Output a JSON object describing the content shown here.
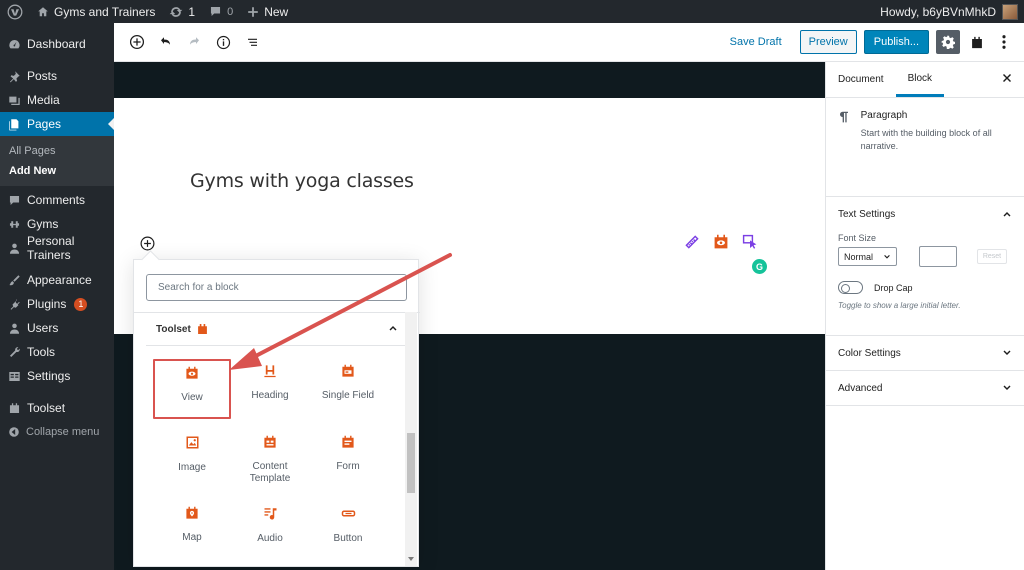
{
  "adminbar": {
    "site_name": "Gyms and Trainers",
    "updates_count": "1",
    "comments_count": "0",
    "new_label": "New",
    "howdy": "Howdy, b6yBVnMhkD"
  },
  "sidebar": {
    "items": [
      {
        "label": "Dashboard"
      },
      {
        "label": "Posts"
      },
      {
        "label": "Media"
      },
      {
        "label": "Pages"
      },
      {
        "label": "Comments"
      },
      {
        "label": "Gyms"
      },
      {
        "label": "Personal Trainers"
      },
      {
        "label": "Appearance"
      },
      {
        "label": "Plugins",
        "badge": "1"
      },
      {
        "label": "Users"
      },
      {
        "label": "Tools"
      },
      {
        "label": "Settings"
      },
      {
        "label": "Toolset"
      },
      {
        "label": "Collapse menu"
      }
    ],
    "submenu": [
      "All Pages",
      "Add New"
    ]
  },
  "header": {
    "save_draft": "Save Draft",
    "preview": "Preview",
    "publish": "Publish..."
  },
  "editor": {
    "post_title": "Gyms with yoga classes"
  },
  "inserter": {
    "search_placeholder": "Search for a block",
    "panel_title": "Toolset",
    "blocks": [
      "View",
      "Heading",
      "Single Field",
      "Image",
      "Content Template",
      "Form",
      "Map",
      "Audio",
      "Button"
    ]
  },
  "settings": {
    "tabs": [
      "Document",
      "Block"
    ],
    "block_name": "Paragraph",
    "block_desc": "Start with the building block of all narrative.",
    "text_settings": "Text Settings",
    "font_size_label": "Font Size",
    "font_size_value": "Normal",
    "reset_label": "Reset",
    "drop_cap": "Drop Cap",
    "drop_cap_help": "Toggle to show a large initial letter.",
    "color_settings": "Color Settings",
    "advanced": "Advanced"
  },
  "colors": {
    "admin_dark": "#23282d",
    "wp_blue": "#0073aa",
    "toolset_orange": "#e2581a",
    "annotation_red": "#d9534f",
    "grammarly_green": "#15c39a"
  }
}
